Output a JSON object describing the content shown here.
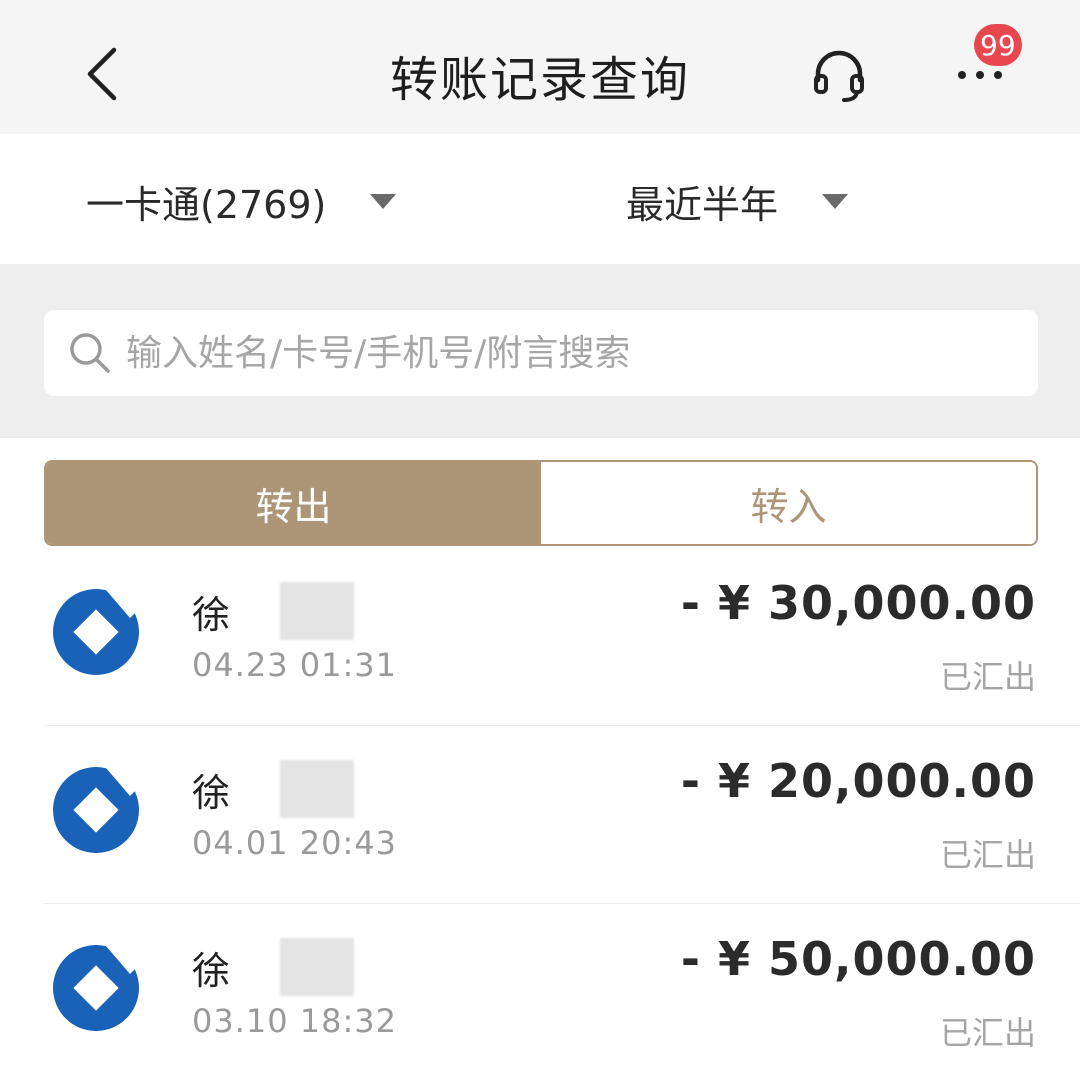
{
  "header": {
    "title": "转账记录查询",
    "badge_count": "99",
    "icons": [
      "back-chevron-icon",
      "headset-icon",
      "more-dots-icon"
    ]
  },
  "filters": {
    "account": "一卡通(2769)",
    "period": "最近半年"
  },
  "search": {
    "placeholder": "输入姓名/卡号/手机号/附言搜索"
  },
  "tabs": [
    {
      "label": "转出",
      "active": true
    },
    {
      "label": "转入",
      "active": false
    }
  ],
  "transactions": [
    {
      "payee": "徐",
      "time": "04.23 01:31",
      "amount": "- ¥ 30,000.00",
      "status": "已汇出"
    },
    {
      "payee": "徐",
      "time": "04.01 20:43",
      "amount": "- ¥ 20,000.00",
      "status": "已汇出"
    },
    {
      "payee": "徐",
      "time": "03.10 18:32",
      "amount": "- ¥ 50,000.00",
      "status": "已汇出"
    }
  ],
  "colors": {
    "accent": "#ad9678",
    "badge": "#e8474f",
    "bank_logo": "#1a62b8"
  }
}
